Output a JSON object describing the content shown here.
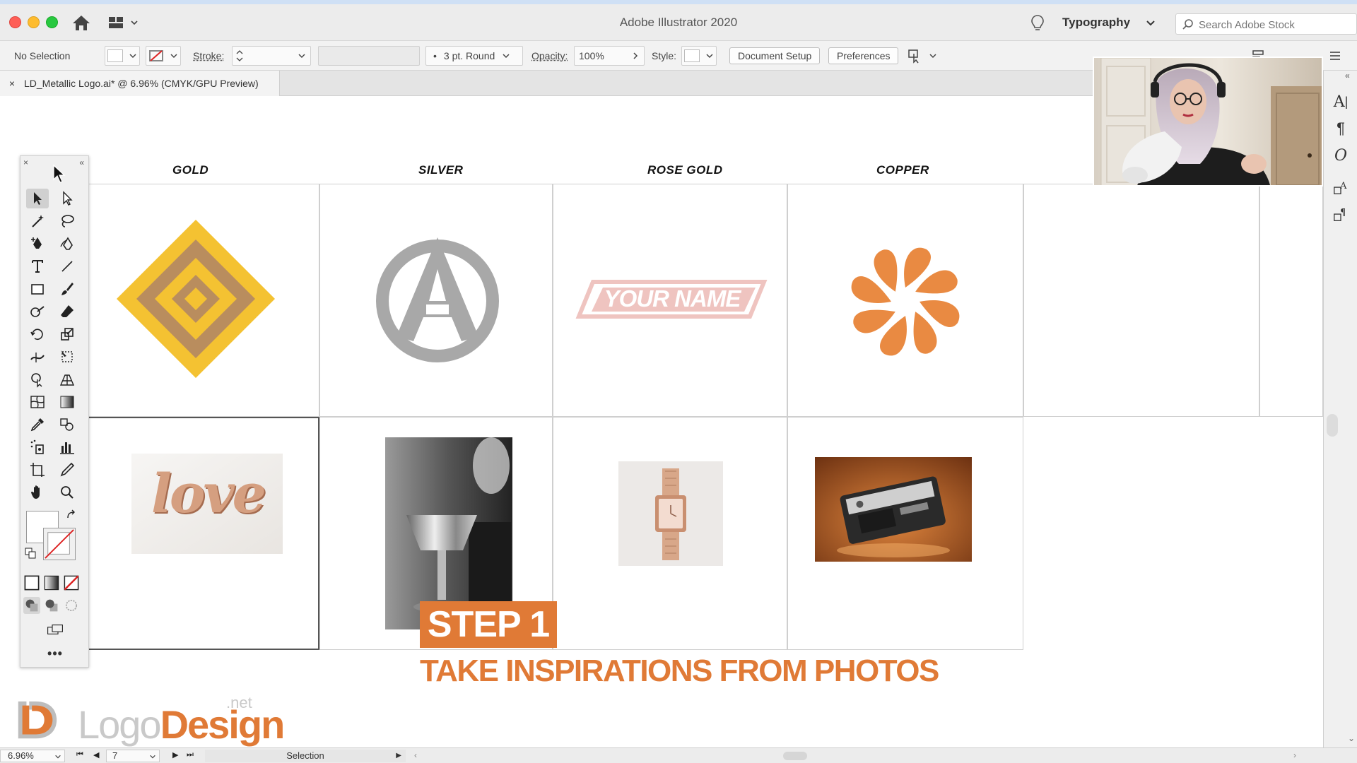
{
  "window": {
    "title": "Adobe Illustrator 2020",
    "workspace": "Typography",
    "stock_search_placeholder": "Search Adobe Stock"
  },
  "control_bar": {
    "selection": "No Selection",
    "stroke_label": "Stroke:",
    "brush": "3 pt. Round",
    "opacity_label": "Opacity:",
    "opacity_value": "100%",
    "style_label": "Style:",
    "document_setup": "Document Setup",
    "preferences": "Preferences"
  },
  "document_tab": {
    "close": "×",
    "label": "LD_Metallic Logo.ai* @ 6.96% (CMYK/GPU Preview)"
  },
  "columns": [
    "GOLD",
    "SILVER",
    "ROSE GOLD",
    "COPPER"
  ],
  "artboards": {
    "rose_gold_logo_text": "YOUR NAME",
    "love_balloon_text": "love"
  },
  "overlay": {
    "step": "STEP 1",
    "subtitle": "TAKE INSPIRATIONS FROM PHOTOS",
    "brand_logo": "Logo",
    "brand_design": "Design",
    "brand_net": ".net"
  },
  "status_bar": {
    "zoom": "6.96%",
    "artboard_number": "7",
    "tool": "Selection"
  },
  "right_panel_icons": [
    "character-icon",
    "paragraph-icon",
    "opentype-icon",
    "character-styles-icon",
    "paragraph-styles-icon"
  ],
  "colors": {
    "accent_orange": "#e07a36",
    "gold_yellow": "#f4c232",
    "gold_brown": "#b98d5e",
    "silver": "#a8a8a8",
    "rose_gold": "#efc4c0",
    "copper": "#e98a42"
  }
}
